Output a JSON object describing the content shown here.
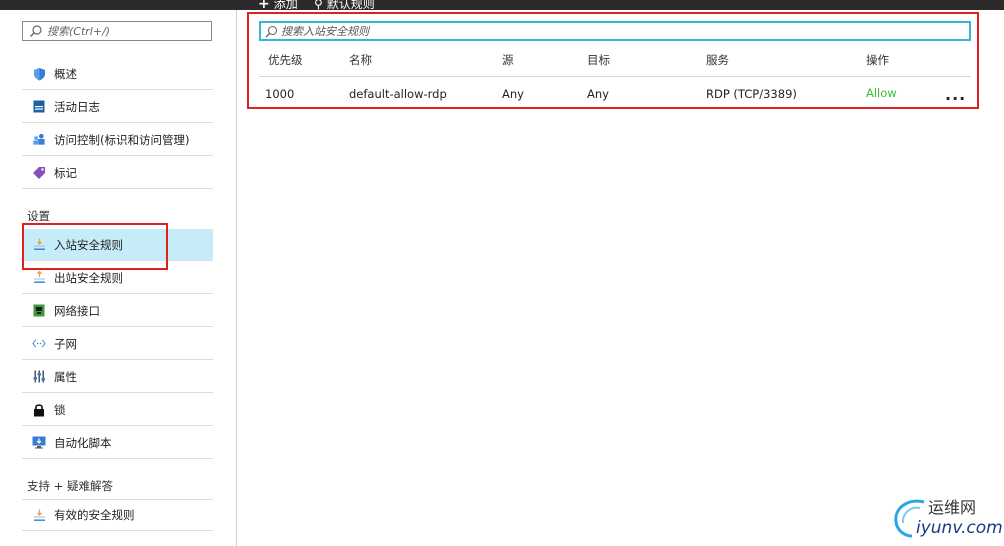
{
  "toolbar": {
    "add_label": "添加",
    "default_rules_label": "默认规则"
  },
  "sidebar": {
    "search_placeholder": "搜索(Ctrl+/)",
    "items": [
      {
        "label": "概述",
        "icon": "shield-icon"
      },
      {
        "label": "活动日志",
        "icon": "log-icon"
      },
      {
        "label": "访问控制(标识和访问管理)",
        "icon": "users-icon"
      },
      {
        "label": "标记",
        "icon": "tag-icon"
      }
    ],
    "section_settings": "设置",
    "settings_items": [
      {
        "label": "入站安全规则",
        "icon": "inbound-rules-icon"
      },
      {
        "label": "出站安全规则",
        "icon": "outbound-rules-icon"
      },
      {
        "label": "网络接口",
        "icon": "network-interface-icon"
      },
      {
        "label": "子网",
        "icon": "subnet-icon"
      },
      {
        "label": "属性",
        "icon": "properties-icon"
      },
      {
        "label": "锁",
        "icon": "lock-icon"
      },
      {
        "label": "自动化脚本",
        "icon": "automation-script-icon"
      }
    ],
    "section_support": "支持 + 疑难解答",
    "support_items": [
      {
        "label": "有效的安全规则",
        "icon": "effective-rules-icon"
      }
    ]
  },
  "rules": {
    "search_placeholder": "搜索入站安全规则",
    "columns": [
      "优先级",
      "名称",
      "源",
      "目标",
      "服务",
      "操作"
    ],
    "rows": [
      {
        "priority": "1000",
        "name": "default-allow-rdp",
        "source": "Any",
        "destination": "Any",
        "service": "RDP (TCP/3389)",
        "action": "Allow"
      }
    ],
    "more": "..."
  },
  "watermark": {
    "cn": "运维网",
    "en": "iyunv.com"
  },
  "colors": {
    "allow": "#3cba3c",
    "active_bg": "#c7ecf9",
    "search_border": "#35b6d6",
    "highlight": "#e0201f"
  }
}
